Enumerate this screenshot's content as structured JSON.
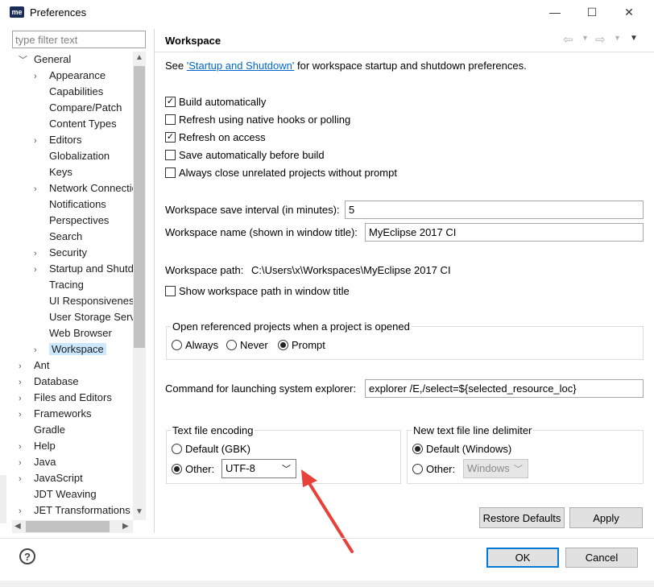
{
  "window": {
    "logo_text": "me",
    "title": "Preferences",
    "minimize": "—",
    "maximize": "☐",
    "close": "✕"
  },
  "filter": {
    "placeholder": "type filter text",
    "value": ""
  },
  "tree": {
    "items": [
      {
        "label": "General",
        "twisty": "﹀",
        "indent": 0,
        "selected": false
      },
      {
        "label": "Appearance",
        "twisty": "›",
        "indent": 1
      },
      {
        "label": "Capabilities",
        "twisty": "",
        "indent": 1
      },
      {
        "label": "Compare/Patch",
        "twisty": "",
        "indent": 1
      },
      {
        "label": "Content Types",
        "twisty": "",
        "indent": 1
      },
      {
        "label": "Editors",
        "twisty": "›",
        "indent": 1
      },
      {
        "label": "Globalization",
        "twisty": "",
        "indent": 1
      },
      {
        "label": "Keys",
        "twisty": "",
        "indent": 1
      },
      {
        "label": "Network Connections",
        "twisty": "›",
        "indent": 1
      },
      {
        "label": "Notifications",
        "twisty": "",
        "indent": 1
      },
      {
        "label": "Perspectives",
        "twisty": "",
        "indent": 1
      },
      {
        "label": "Search",
        "twisty": "",
        "indent": 1
      },
      {
        "label": "Security",
        "twisty": "›",
        "indent": 1
      },
      {
        "label": "Startup and Shutdown",
        "twisty": "›",
        "indent": 1
      },
      {
        "label": "Tracing",
        "twisty": "",
        "indent": 1
      },
      {
        "label": "UI Responsiveness Monitoring",
        "twisty": "",
        "indent": 1
      },
      {
        "label": "User Storage Service",
        "twisty": "",
        "indent": 1
      },
      {
        "label": "Web Browser",
        "twisty": "",
        "indent": 1
      },
      {
        "label": "Workspace",
        "twisty": "›",
        "indent": 1,
        "selected": true
      },
      {
        "label": "Ant",
        "twisty": "›",
        "indent": 0
      },
      {
        "label": "Database",
        "twisty": "›",
        "indent": 0
      },
      {
        "label": "Files and Editors",
        "twisty": "›",
        "indent": 0
      },
      {
        "label": "Frameworks",
        "twisty": "›",
        "indent": 0
      },
      {
        "label": "Gradle",
        "twisty": "",
        "indent": 0
      },
      {
        "label": "Help",
        "twisty": "›",
        "indent": 0
      },
      {
        "label": "Java",
        "twisty": "›",
        "indent": 0
      },
      {
        "label": "JavaScript",
        "twisty": "›",
        "indent": 0
      },
      {
        "label": "JDT Weaving",
        "twisty": "",
        "indent": 0
      },
      {
        "label": "JET Transformations",
        "twisty": "›",
        "indent": 0
      }
    ]
  },
  "page": {
    "title": "Workspace",
    "see_prefix": "See ",
    "see_link": "'Startup and Shutdown'",
    "see_suffix": " for workspace startup and shutdown preferences.",
    "checkboxes": [
      {
        "label": "Build automatically",
        "checked": true
      },
      {
        "label": "Refresh using native hooks or polling",
        "checked": false
      },
      {
        "label": "Refresh on access",
        "checked": true
      },
      {
        "label": "Save automatically before build",
        "checked": false
      },
      {
        "label": "Always close unrelated projects without prompt",
        "checked": false
      }
    ],
    "save_interval_label": "Workspace save interval (in minutes):",
    "save_interval_value": "5",
    "ws_name_label": "Workspace name (shown in window title):",
    "ws_name_value": "MyEclipse 2017 CI",
    "ws_path_label": "Workspace path:",
    "ws_path_value": "C:\\Users\\x\\Workspaces\\MyEclipse 2017 CI",
    "show_path_label": "Show workspace path in window title",
    "show_path_checked": false,
    "open_ref": {
      "title": "Open referenced projects when a project is opened",
      "options": [
        "Always",
        "Never",
        "Prompt"
      ],
      "selected": "Prompt"
    },
    "cmd_label": "Command for launching system explorer:",
    "cmd_value": "explorer /E,/select=${selected_resource_loc}",
    "encoding": {
      "title": "Text file encoding",
      "default_label": "Default (GBK)",
      "other_label": "Other:",
      "selected": "other",
      "other_value": "UTF-8"
    },
    "delimiter": {
      "title": "New text file line delimiter",
      "default_label": "Default (Windows)",
      "other_label": "Other:",
      "selected": "default",
      "other_value": "Windows"
    },
    "restore_label": "Restore Defaults",
    "apply_label": "Apply"
  },
  "footer": {
    "help": "?",
    "ok_label": "OK",
    "cancel_label": "Cancel"
  },
  "annotation_color": "#e8403a"
}
